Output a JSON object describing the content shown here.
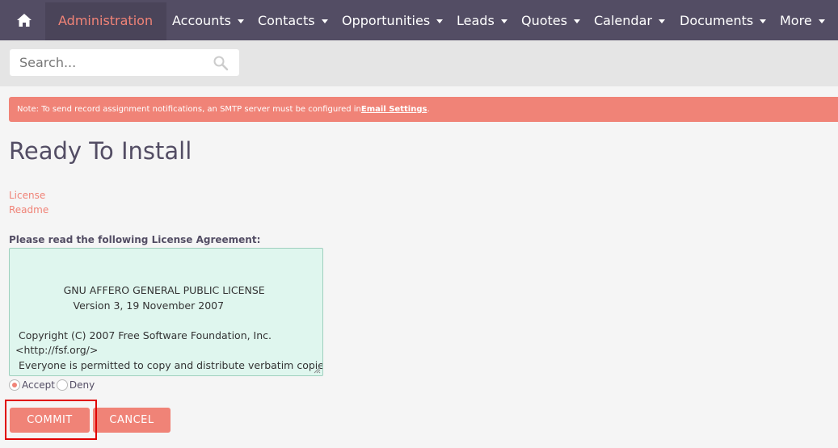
{
  "nav": {
    "home_icon": "home-icon",
    "items": [
      {
        "label": "Administration",
        "active": true
      },
      {
        "label": "Accounts"
      },
      {
        "label": "Contacts"
      },
      {
        "label": "Opportunities"
      },
      {
        "label": "Leads"
      },
      {
        "label": "Quotes"
      },
      {
        "label": "Calendar"
      },
      {
        "label": "Documents"
      },
      {
        "label": "More"
      }
    ]
  },
  "search": {
    "placeholder": "Search...",
    "icon": "search-icon"
  },
  "notice": {
    "text": "Note: To send record assignment notifications, an SMTP server must be configured in ",
    "link_text": "Email Settings",
    "suffix": "."
  },
  "page": {
    "title": "Ready To Install"
  },
  "links": {
    "license": "License",
    "readme": "Readme"
  },
  "license": {
    "label": "Please read the following License Agreement:",
    "text": "               GNU AFFERO GENERAL PUBLIC LICENSE\n                  Version 3, 19 November 2007\n\n Copyright (C) 2007 Free Software Foundation, Inc.\n<http://fsf.org/>\n Everyone is permitted to copy and distribute verbatim copies\n of this license document, but changing it is not allowed."
  },
  "options": {
    "accept": "Accept",
    "deny": "Deny",
    "selected": "Accept"
  },
  "buttons": {
    "commit": "COMMIT",
    "cancel": "CANCEL"
  },
  "colors": {
    "nav_bg": "#534d64",
    "accent": "#f08377",
    "license_bg": "#dff6ee",
    "highlight": "#e00000"
  }
}
